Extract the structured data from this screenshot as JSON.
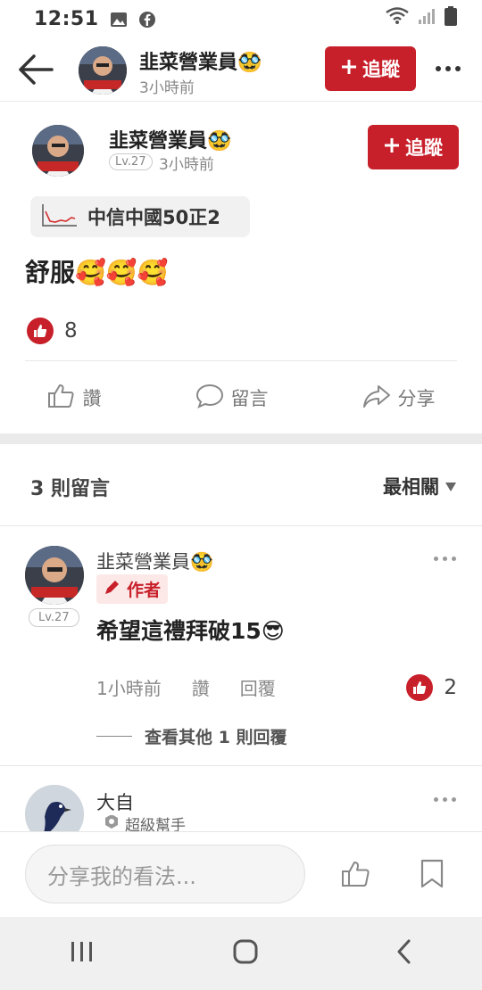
{
  "status_bar": {
    "time": "12:51"
  },
  "top_bar": {
    "username": "韭菜營業員🥸",
    "time_ago": "3小時前",
    "follow_label": "追蹤"
  },
  "post": {
    "username": "韭菜營業員🥸",
    "level": "Lv.27",
    "time_ago": "3小時前",
    "follow_label": "追蹤",
    "stock_tag": "中信中國50正2",
    "content": "舒服🥰🥰🥰",
    "like_count": "8",
    "actions": {
      "like": "讚",
      "comment": "留言",
      "share": "分享"
    }
  },
  "comments_header": {
    "count_label": "3 則留言",
    "sort_label": "最相關"
  },
  "comments": [
    {
      "username": "韭菜營業員🥸",
      "author_badge": "作者",
      "level": "Lv.27",
      "text": "希望這禮拜破15😎",
      "time_ago": "1小時前",
      "like_label": "讚",
      "reply_label": "回覆",
      "like_count": "2",
      "view_more": "查看其他 1 則回覆"
    },
    {
      "username": "大自",
      "badge": "超級幫手"
    }
  ],
  "composer": {
    "placeholder": "分享我的看法..."
  },
  "colors": {
    "accent": "#c8202b"
  }
}
